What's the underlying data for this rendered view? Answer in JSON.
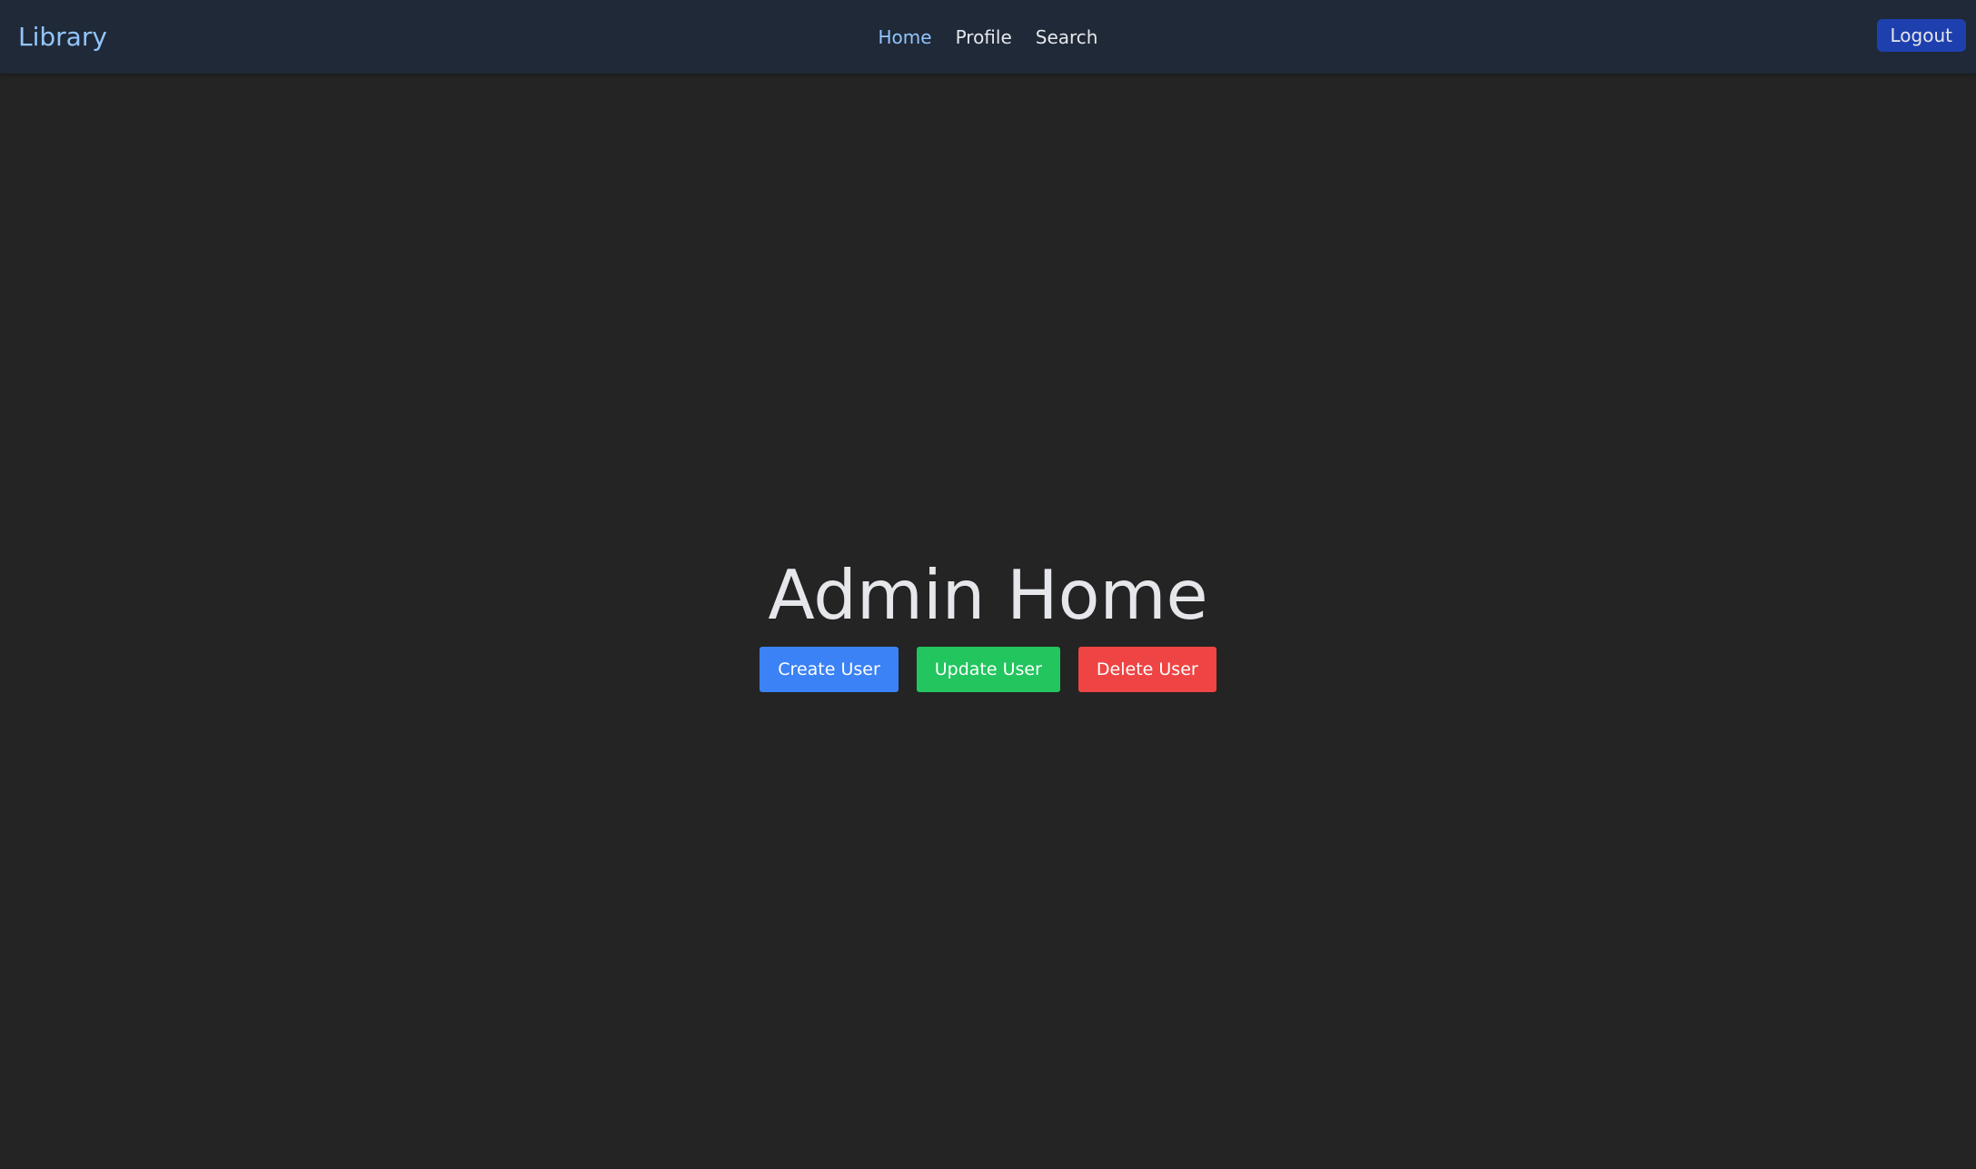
{
  "navbar": {
    "brand": "Library",
    "links": [
      {
        "label": "Home",
        "active": true
      },
      {
        "label": "Profile",
        "active": false
      },
      {
        "label": "Search",
        "active": false
      }
    ],
    "logout_label": "Logout"
  },
  "main": {
    "title": "Admin Home",
    "buttons": {
      "create": "Create User",
      "update": "Update User",
      "delete": "Delete User"
    }
  },
  "colors": {
    "page_background": "#242424",
    "navbar_background": "#1f2937",
    "accent": "#93c5fd",
    "logout": "#1e40af",
    "create": "#3b82f6",
    "update": "#22c55e",
    "delete": "#ef4444"
  }
}
